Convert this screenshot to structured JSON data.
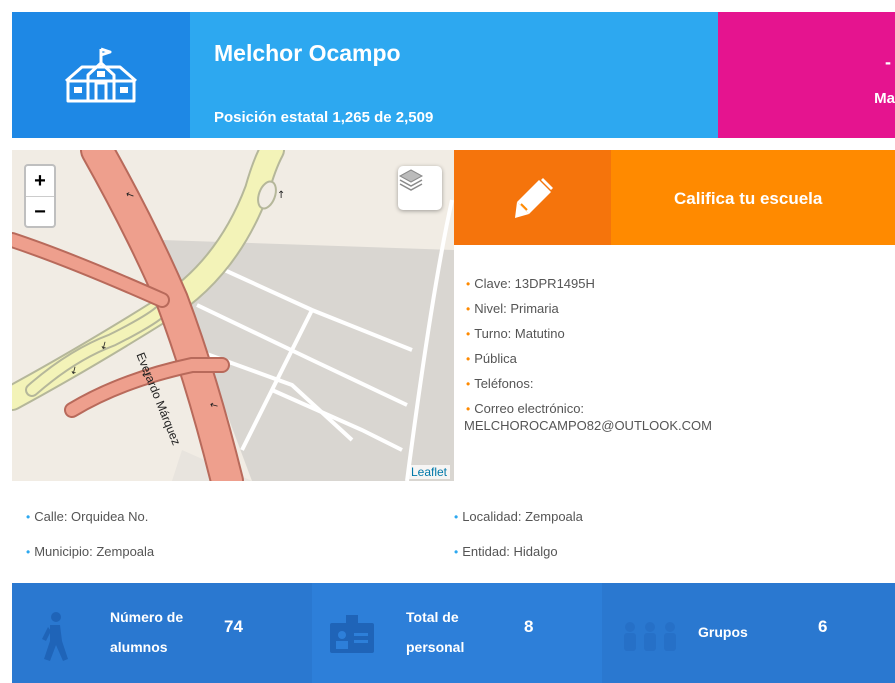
{
  "header": {
    "school_name": "Melchor Ocampo",
    "state_rank": "Posición estatal 1,265 de 2,509",
    "icon": "school-building-icon",
    "right_panel_dash": "-",
    "right_panel_text": "Ma"
  },
  "map": {
    "zoom_in": "+",
    "zoom_out": "−",
    "street_label": "Everardo Márquez",
    "attribution": "Leaflet",
    "layers_icon": "layers-icon"
  },
  "rate": {
    "label": "Califica tu escuela",
    "icon": "pen-icon"
  },
  "info": {
    "clave": "Clave: 13DPR1495H",
    "nivel": "Nivel: Primaria",
    "turno": "Turno: Matutino",
    "tipo": "Pública",
    "telefonos": "Teléfonos:",
    "correo_label": "Correo electrónico:",
    "correo_value": "MELCHOROCAMPO82@OUTLOOK.COM"
  },
  "address": {
    "calle": "Calle: Orquidea No.",
    "municipio": "Municipio: Zempoala",
    "localidad": "Localidad: Zempoala",
    "entidad": "Entidad: Hidalgo"
  },
  "stats": {
    "alumnos_label_1": "Número de",
    "alumnos_label_2": "alumnos",
    "alumnos_value": "74",
    "personal_label_1": "Total de",
    "personal_label_2": "personal",
    "personal_value": "8",
    "grupos_label": "Grupos",
    "grupos_value": "6"
  },
  "colors": {
    "header_dark_blue": "#1e88e5",
    "header_blue": "#2da8f0",
    "magenta": "#e5148f",
    "orange": "#ff8a00",
    "stats_blue": "#2d7fd9"
  }
}
